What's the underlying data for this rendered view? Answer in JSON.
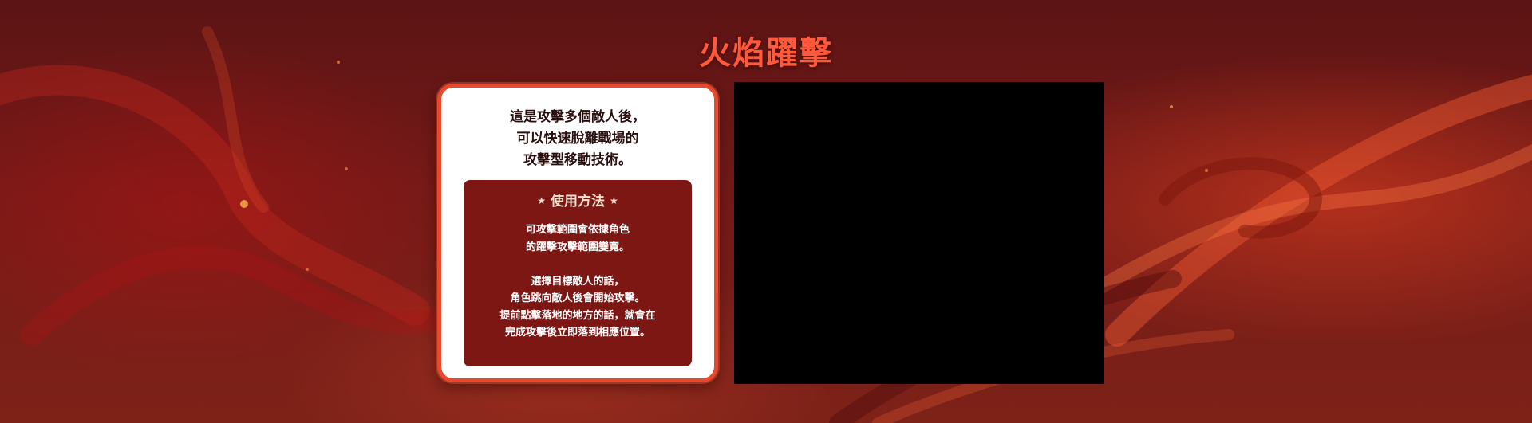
{
  "page": {
    "title": "火焰躍擊"
  },
  "card": {
    "intro": "這是攻擊多個敵人後，\n可以快速脫離戰場的\n攻擊型移動技術。",
    "usage": {
      "star_icon": "★",
      "heading": "使用方法",
      "description": "可攻擊範圍會依據角色\n的躍擊攻擊範圍變寬。\n\n選擇目標敵人的話，\n角色跳向敵人後會開始攻擊。\n提前點擊落地的地方的話，就會在\n完成攻擊後立即落到相應位置。"
    }
  },
  "colors": {
    "title": "#ff5a3c",
    "card_border": "#e8482b",
    "usage_box": "#7c1714",
    "video_bg": "#000000"
  }
}
